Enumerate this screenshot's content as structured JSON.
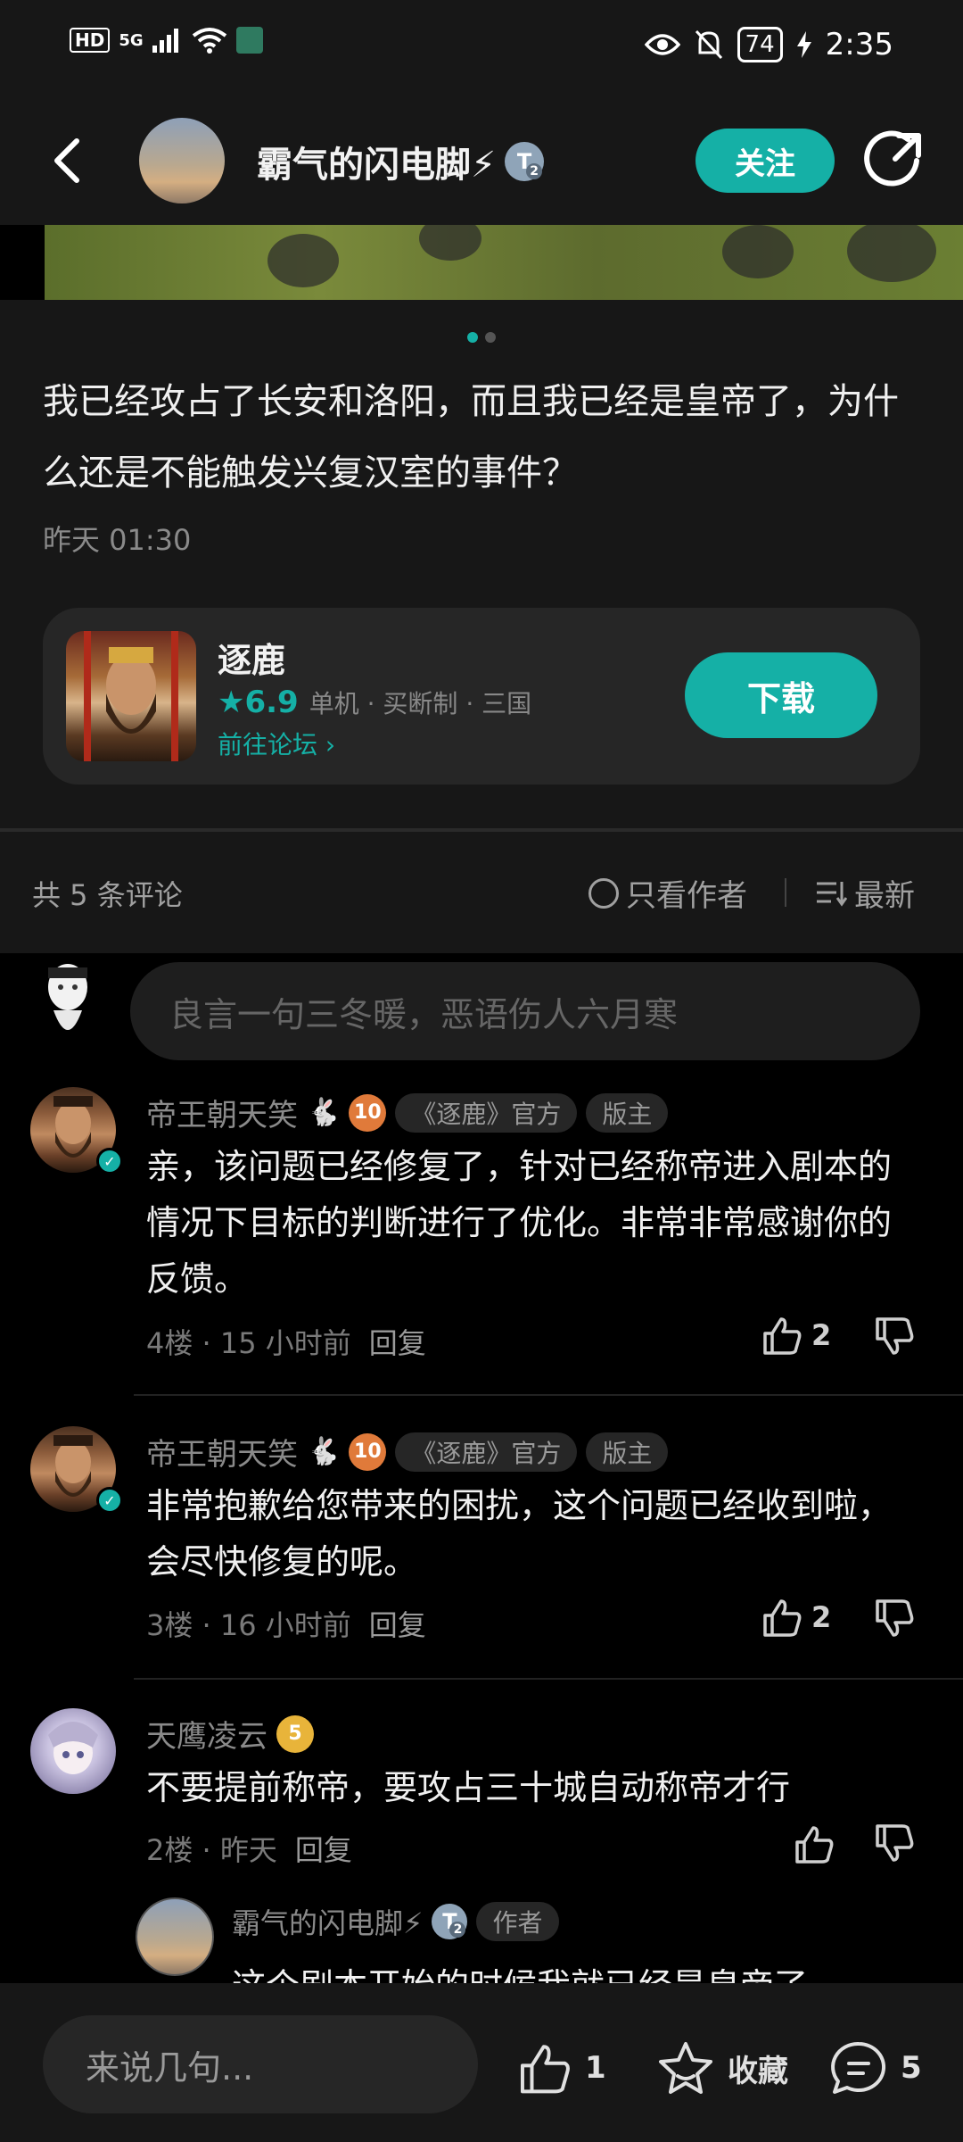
{
  "status_bar": {
    "left_indicators": [
      "HD",
      "5G"
    ],
    "battery": "74",
    "time": "2:35"
  },
  "header": {
    "author_name": "霸气的闪电脚⚡",
    "level_badge": "T",
    "level_num": "2",
    "follow_label": "关注"
  },
  "post": {
    "title": "我已经攻占了长安和洛阳，而且我已经是皇帝了，为什么还是不能触发兴复汉室的事件？",
    "time": "昨天 01:30",
    "carousel": {
      "count": 2,
      "active": 0
    }
  },
  "game_card": {
    "name": "逐鹿",
    "rating": "6.9",
    "tags": "单机 · 买断制 · 三国",
    "forum_link": "前往论坛",
    "download_label": "下载"
  },
  "comments_bar": {
    "count_label": "共 5 条评论",
    "only_author_label": "只看作者",
    "sort_label": "最新"
  },
  "comment_input": {
    "placeholder": "良言一句三冬暖，恶语伤人六月寒"
  },
  "comments": [
    {
      "user": "帝王朝天笑",
      "level": "10",
      "tag_official": "《逐鹿》官方",
      "tag_role": "版主",
      "text": "亲，该问题已经修复了，针对已经称帝进入剧本的情况下目标的判断进行了优化。非常非常感谢你的反馈。",
      "floor_time": "4楼 · 15 小时前",
      "reply_label": "回复",
      "likes": "2"
    },
    {
      "user": "帝王朝天笑",
      "level": "10",
      "tag_official": "《逐鹿》官方",
      "tag_role": "版主",
      "text": "非常抱歉给您带来的困扰，这个问题已经收到啦，会尽快修复的呢。",
      "floor_time": "3楼 · 16 小时前",
      "reply_label": "回复",
      "likes": "2"
    },
    {
      "user": "天鹰凌云",
      "level": "5",
      "text": "不要提前称帝，要攻占三十城自动称帝才行",
      "floor_time": "2楼 · 昨天",
      "reply_label": "回复",
      "reply": {
        "user": "霸气的闪电脚⚡",
        "level": "2",
        "tag": "作者",
        "text": "这个剧本开始的时候我就已经是皇帝了"
      }
    }
  ],
  "bottom_bar": {
    "input_placeholder": "来说几句...",
    "likes": "1",
    "favorite_label": "收藏",
    "comments": "5"
  },
  "colors": {
    "accent": "#15b0a6",
    "background": "#171717"
  }
}
